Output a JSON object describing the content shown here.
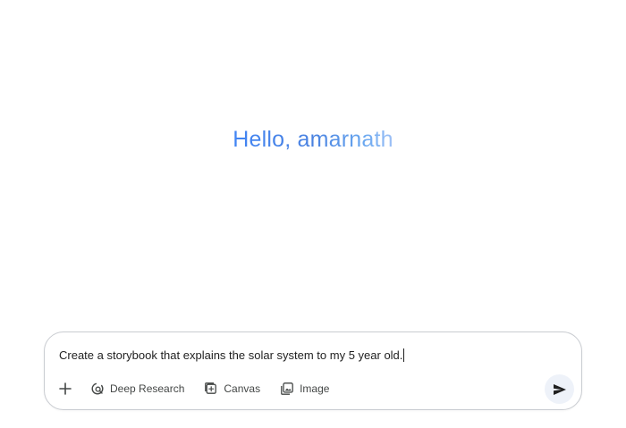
{
  "greeting": {
    "text": "Hello, amarnath"
  },
  "composer": {
    "prompt_value": "Create a storybook that explains the solar system to my 5 year old.",
    "tools": [
      {
        "label": "Deep Research",
        "icon": "deep-research-icon"
      },
      {
        "label": "Canvas",
        "icon": "canvas-icon"
      },
      {
        "label": "Image",
        "icon": "image-icon"
      }
    ],
    "add_icon": "plus-icon",
    "send_icon": "send-icon"
  },
  "colors": {
    "greeting_gradient_start": "#4285f4",
    "greeting_gradient_end": "#9fc1f6",
    "text": "#1f1f1f",
    "tool_text": "#444746",
    "border": "#c9ccd1",
    "send_bg": "#eef2f9"
  }
}
